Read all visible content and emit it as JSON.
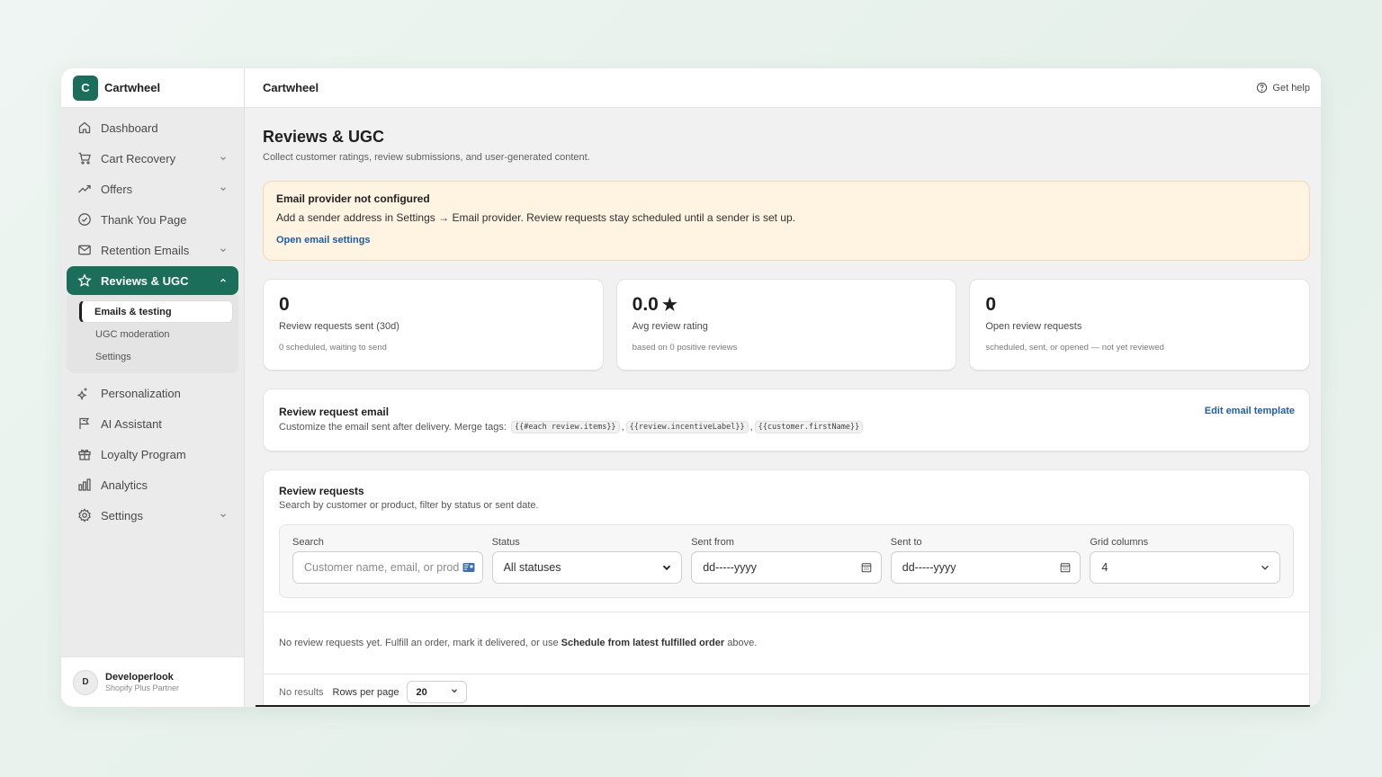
{
  "app": {
    "logo_letter": "C",
    "name": "Cartwheel"
  },
  "sidebar": {
    "items": [
      {
        "label": "Dashboard",
        "icon": "home-icon"
      },
      {
        "label": "Cart Recovery",
        "icon": "cart-icon"
      },
      {
        "label": "Offers",
        "icon": "trend-icon"
      },
      {
        "label": "Thank You Page",
        "icon": "check-circle-icon"
      },
      {
        "label": "Retention Emails",
        "icon": "mail-icon"
      },
      {
        "label": "Reviews & UGC",
        "icon": "star-icon"
      },
      {
        "label": "Personalization",
        "icon": "sparkle-icon"
      },
      {
        "label": "AI Assistant",
        "icon": "flag-icon"
      },
      {
        "label": "Loyalty Program",
        "icon": "gift-icon"
      },
      {
        "label": "Analytics",
        "icon": "bar-chart-icon"
      },
      {
        "label": "Settings",
        "icon": "gear-icon"
      }
    ],
    "sub_items": [
      "Emails & testing",
      "UGC moderation",
      "Settings"
    ]
  },
  "user": {
    "initial": "D",
    "name": "Developerlook",
    "role": "Shopify Plus Partner"
  },
  "topbar": {
    "title": "Cartwheel",
    "help": "Get help"
  },
  "page": {
    "title": "Reviews & UGC",
    "subtitle": "Collect customer ratings, review submissions, and user-generated content."
  },
  "banner": {
    "title": "Email provider not configured",
    "text": "Add a sender address in Settings → Email provider. Review requests stay scheduled until a sender is set up.",
    "link": "Open email settings"
  },
  "stats": [
    {
      "value": "0",
      "label": "Review requests sent (30d)",
      "note": "0 scheduled, waiting to send"
    },
    {
      "value": "0.0",
      "label": "Avg review rating",
      "note": "based on 0 positive reviews"
    },
    {
      "value": "0",
      "label": "Open review requests",
      "note": "scheduled, sent, or opened — not yet reviewed"
    }
  ],
  "email_card": {
    "title": "Review request email",
    "desc": "Customize the email sent after delivery. Merge tags:",
    "tags": [
      "{{#each review.items}}",
      "{{review.incentiveLabel}}",
      "{{customer.firstName}}"
    ],
    "edit": "Edit email template"
  },
  "requests": {
    "title": "Review requests",
    "subtitle": "Search by customer or product, filter by status or sent date.",
    "filters": {
      "search_label": "Search",
      "search_placeholder": "Customer name, email, or prod",
      "status_label": "Status",
      "status_value": "All statuses",
      "from_label": "Sent from",
      "from_value": "dd-----yyyy",
      "to_label": "Sent to",
      "to_value": "dd-----yyyy",
      "grid_label": "Grid columns",
      "grid_value": "4"
    },
    "empty_prefix": "No review requests yet. Fulfill an order, mark it delivered, or use ",
    "empty_bold": "Schedule from latest fulfilled order",
    "empty_suffix": " above.",
    "no_results": "No results",
    "rows_label": "Rows per page",
    "rows_value": "20"
  }
}
